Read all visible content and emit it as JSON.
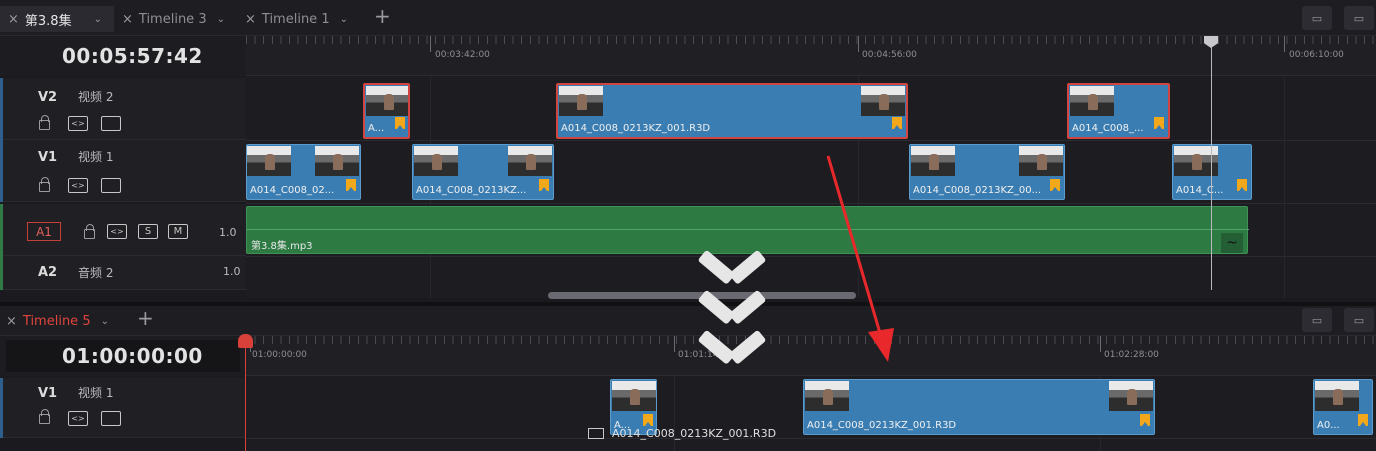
{
  "top_tabs": [
    {
      "label": "第3.8集",
      "active": true
    },
    {
      "label": "Timeline 3",
      "active": false
    },
    {
      "label": "Timeline 1",
      "active": false
    }
  ],
  "top_timecode": "00:05:57:42",
  "top_ruler": [
    "00:03:42:00",
    "00:04:56:00",
    "00:06:10:00"
  ],
  "top_tracks": {
    "v2": {
      "name": "V2",
      "label": "视频 2"
    },
    "v1": {
      "name": "V1",
      "label": "视频 1"
    },
    "a1": {
      "name": "A1",
      "value": "1.0",
      "solo": "S",
      "mute": "M"
    },
    "a2": {
      "name": "A2",
      "label": "音频 2",
      "value": "1.0"
    }
  },
  "top_clips": {
    "v2_a": "A...",
    "v2_b": "A014_C008_0213KZ_001.R3D",
    "v2_c": "A014_C008_...",
    "v1_a": "A014_C008_02...",
    "v1_b": "A014_C008_0213KZ...",
    "v1_c": "A014_C008_0213KZ_00...",
    "v1_d": "A014_C...",
    "audio": "第3.8集.mp3"
  },
  "bottom_tabs": [
    {
      "label": "Timeline 5",
      "active": true
    }
  ],
  "bottom_timecode": "01:00:00:00",
  "bottom_ruler": [
    "01:00:00:00",
    "01:01:14:00",
    "01:02:28:00"
  ],
  "bottom_tracks": {
    "v1": {
      "name": "V1",
      "label": "视频 1"
    }
  },
  "bottom_clips": {
    "c1": "A...",
    "c2": "A014_C008_0213KZ_001.R3D",
    "c3": "A0...",
    "drag_ghost": "A014_C008_0213KZ_001.R3D"
  },
  "icons": {
    "tab_close": "×",
    "tab_chevron": "⌄",
    "add_tab": "+"
  },
  "colors": {
    "clip_blue": "#3a7db2",
    "clip_selected_border": "#d0453f",
    "audio_green": "#2d7a43",
    "flag_orange": "#f3a71a",
    "timeline5_red": "#e0443c",
    "arrow_red": "#e8282a"
  }
}
